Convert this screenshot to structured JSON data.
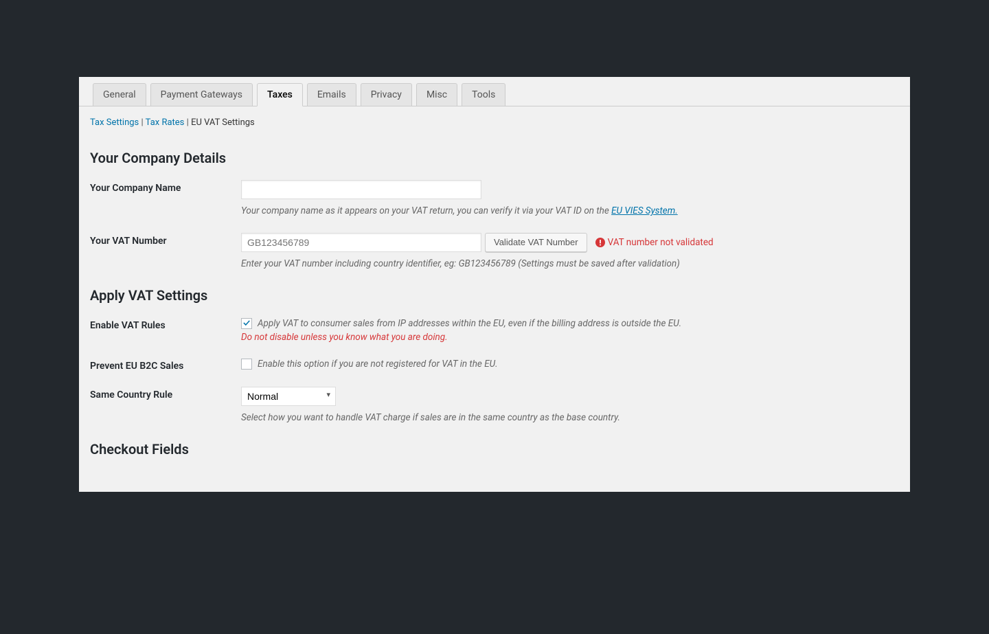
{
  "tabs": {
    "items": [
      "General",
      "Payment Gateways",
      "Taxes",
      "Emails",
      "Privacy",
      "Misc",
      "Tools"
    ],
    "activeIndex": 2
  },
  "subnav": {
    "tax_settings": "Tax Settings",
    "tax_rates": "Tax Rates",
    "current": "EU VAT Settings",
    "sep": "|"
  },
  "sections": {
    "company": "Your Company Details",
    "apply": "Apply VAT Settings",
    "checkout": "Checkout Fields"
  },
  "company_name": {
    "label": "Your Company Name",
    "value": "",
    "help_prefix": "Your company name as it appears on your VAT return, you can verify it via your VAT ID on the ",
    "help_link": "EU VIES System."
  },
  "vat_number": {
    "label": "Your VAT Number",
    "placeholder": "GB123456789",
    "value": "",
    "button": "Validate VAT Number",
    "status": "VAT number not validated",
    "help": "Enter your VAT number including country identifier, eg: GB123456789 (Settings must be saved after validation)"
  },
  "enable_vat": {
    "label": "Enable VAT Rules",
    "checked": true,
    "desc": "Apply VAT to consumer sales from IP addresses within the EU, even if the billing address is outside the EU.",
    "warn": "Do not disable unless you know what you are doing."
  },
  "prevent_b2c": {
    "label": "Prevent EU B2C Sales",
    "checked": false,
    "desc": "Enable this option if you are not registered for VAT in the EU."
  },
  "same_country": {
    "label": "Same Country Rule",
    "value": "Normal",
    "help": "Select how you want to handle VAT charge if sales are in the same country as the base country."
  }
}
